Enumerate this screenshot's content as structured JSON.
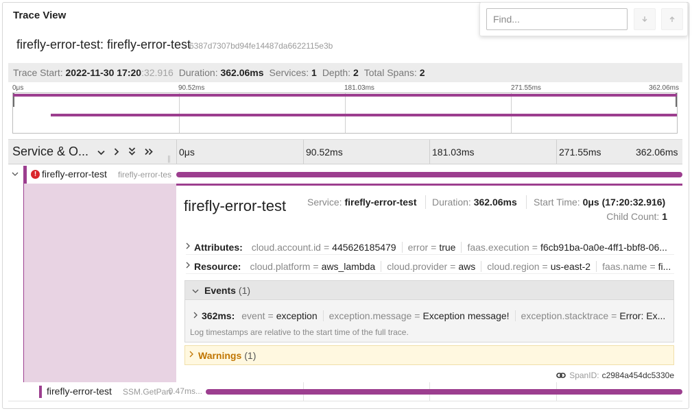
{
  "panel": {
    "title": "Trace View"
  },
  "search": {
    "placeholder": "Find...",
    "next_icon": "arrow-down-icon",
    "prev_icon": "arrow-up-icon"
  },
  "trace": {
    "name": "firefly-error-test: firefly-error-test",
    "id": "6387d7307bd94fe14487da6622115e3b"
  },
  "stats": {
    "start_label": "Trace Start:",
    "start_main": "2022-11-30 17:20",
    "start_sub": ":32.916",
    "duration_label": "Duration:",
    "duration": "362.06ms",
    "services_label": "Services:",
    "services": "1",
    "depth_label": "Depth:",
    "depth": "2",
    "spans_label": "Total Spans:",
    "spans": "2"
  },
  "minimap": {
    "ticks": [
      "0μs",
      "90.52ms",
      "181.03ms",
      "271.55ms",
      "362.06ms"
    ]
  },
  "header": {
    "title": "Service & O...",
    "controls": [
      "collapse-one-icon",
      "expand-one-icon",
      "collapse-all-icon",
      "expand-all-icon"
    ],
    "ticks": [
      "0μs",
      "90.52ms",
      "181.03ms",
      "271.55ms",
      "362.06ms"
    ]
  },
  "spans": [
    {
      "service": "firefly-error-test",
      "operation": "firefly-error-test",
      "error": true,
      "start_fraction": 0,
      "duration_fraction": 1
    },
    {
      "service": "firefly-error-test",
      "operation": "SSM.GetParameter",
      "duration": "...0.47ms",
      "start_fraction": 0.06,
      "duration_fraction": 0.94
    }
  ],
  "detail": {
    "title": "firefly-error-test",
    "service_label": "Service:",
    "service": "firefly-error-test",
    "duration_label": "Duration:",
    "duration": "362.06ms",
    "start_label": "Start Time:",
    "start": "0μs (17:20:32.916)",
    "child_label": "Child Count:",
    "child": "1",
    "attributes": {
      "label": "Attributes:",
      "items": [
        {
          "key": "cloud.account.id",
          "value": "445626185479"
        },
        {
          "key": "error",
          "value": "true"
        },
        {
          "key": "faas.execution",
          "value": "f6cb91ba-0a0e-4ff1-bbf8-06..."
        }
      ]
    },
    "resource": {
      "label": "Resource:",
      "items": [
        {
          "key": "cloud.platform",
          "value": "aws_lambda"
        },
        {
          "key": "cloud.provider",
          "value": "aws"
        },
        {
          "key": "cloud.region",
          "value": "us-east-2"
        },
        {
          "key": "faas.name",
          "value": "fi..."
        }
      ]
    },
    "events": {
      "label": "Events",
      "count": "(1)",
      "item": {
        "time": "362ms:",
        "fields": [
          {
            "key": "event",
            "value": "exception"
          },
          {
            "key": "exception.message",
            "value": "Exception message!"
          },
          {
            "key": "exception.stacktrace",
            "value": "Error: Ex..."
          }
        ]
      },
      "note": "Log timestamps are relative to the start time of the full trace."
    },
    "warnings": {
      "label": "Warnings",
      "count": "(1)"
    },
    "span_id_label": "SpanID:",
    "span_id": "c2984a454dc5330e"
  },
  "colors": {
    "span": "#9c3e8f",
    "error": "#d9262b",
    "warning": "#c07500",
    "detail_bg": "#e8d3e3"
  }
}
